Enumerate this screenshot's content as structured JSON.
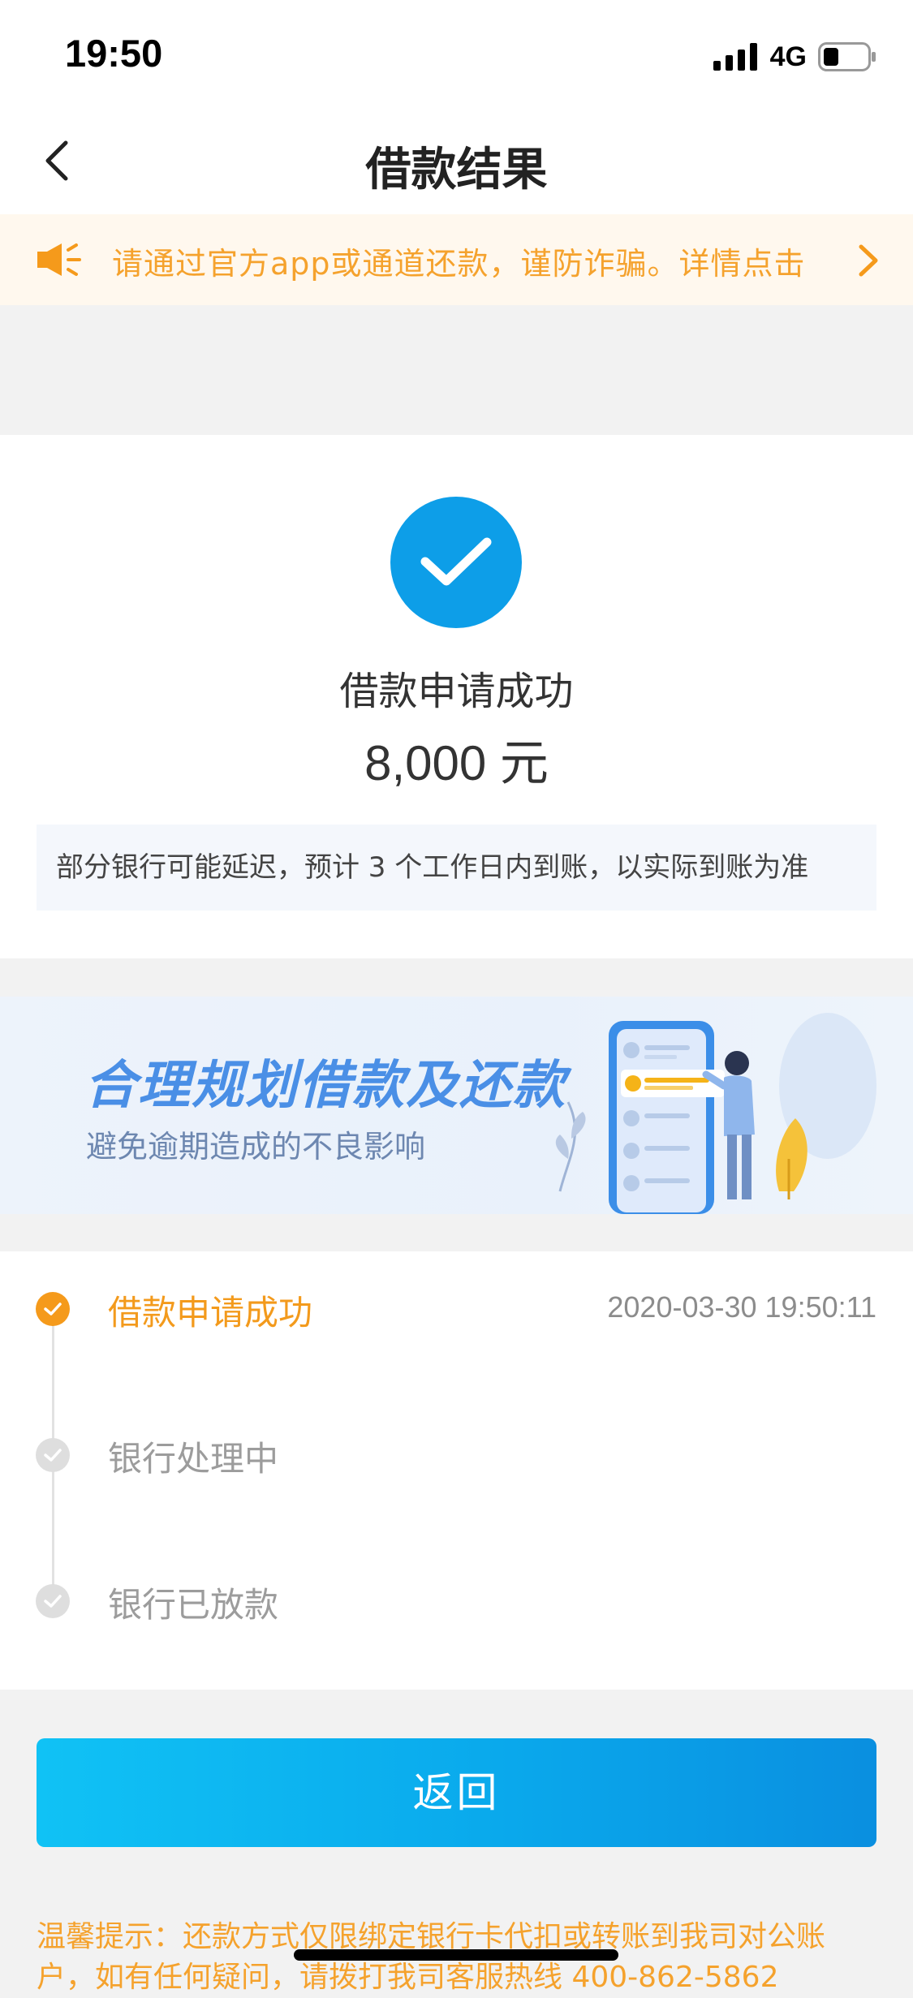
{
  "status_bar": {
    "time": "19:50",
    "network": "4G",
    "battery_level": 0.3
  },
  "nav": {
    "title": "借款结果"
  },
  "notice": {
    "text": "请通过官方app或通道还款，谨防诈骗。详情点击"
  },
  "result": {
    "title": "借款申请成功",
    "amount": "8,000 元",
    "note": "部分银行可能延迟，预计 3 个工作日内到账，以实际到账为准"
  },
  "banner": {
    "title": "合理规划借款及还款",
    "subtitle": "避免逾期造成的不良影响"
  },
  "timeline": {
    "steps": [
      {
        "label": "借款申请成功",
        "time": "2020-03-30 19:50:11",
        "state": "done"
      },
      {
        "label": "银行处理中",
        "time": "",
        "state": "pending"
      },
      {
        "label": "银行已放款",
        "time": "",
        "state": "pending"
      }
    ]
  },
  "actions": {
    "back_label": "返回"
  },
  "tip": {
    "text": "温馨提示：还款方式仅限绑定银行卡代扣或转账到我司对公账户，如有任何疑问，请拨打我司客服热线 400-862-5862"
  },
  "colors": {
    "accent": "#0d9ee8",
    "warning": "#f5a22d",
    "button_start": "#10c2f5",
    "button_end": "#0a8fe0"
  }
}
